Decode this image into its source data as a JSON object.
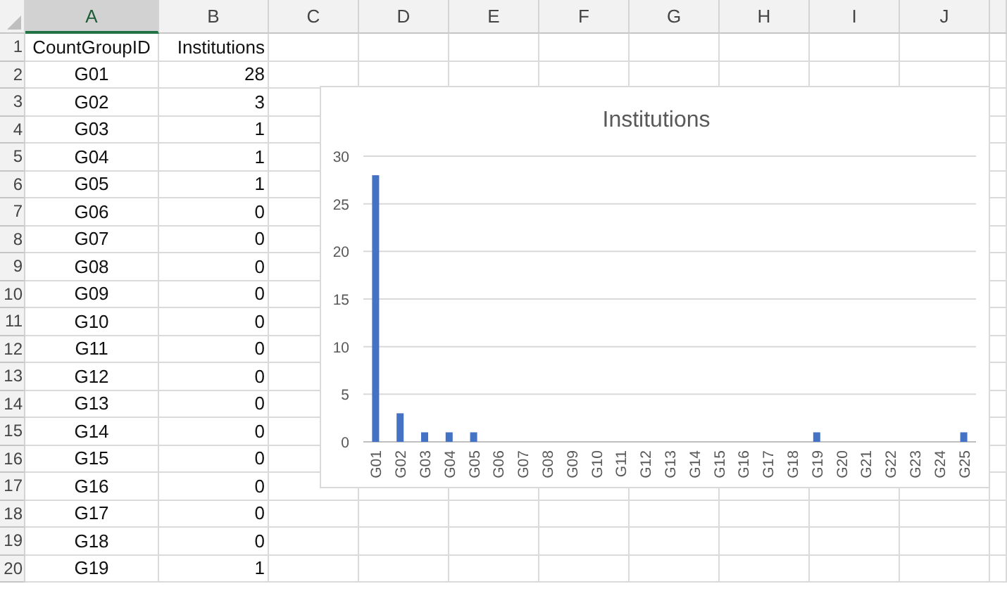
{
  "sheet": {
    "columns": [
      {
        "label": "A",
        "selected": true
      },
      {
        "label": "B",
        "selected": false
      },
      {
        "label": "C",
        "selected": false
      },
      {
        "label": "D",
        "selected": false
      },
      {
        "label": "E",
        "selected": false
      },
      {
        "label": "F",
        "selected": false
      },
      {
        "label": "G",
        "selected": false
      },
      {
        "label": "H",
        "selected": false
      },
      {
        "label": "I",
        "selected": false
      },
      {
        "label": "J",
        "selected": false
      }
    ],
    "rows": [
      {
        "number": "1",
        "cells": [
          "CountGroupID",
          "Institutions"
        ]
      },
      {
        "number": "2",
        "cells": [
          "G01",
          "28"
        ]
      },
      {
        "number": "3",
        "cells": [
          "G02",
          "3"
        ]
      },
      {
        "number": "4",
        "cells": [
          "G03",
          "1"
        ]
      },
      {
        "number": "5",
        "cells": [
          "G04",
          "1"
        ]
      },
      {
        "number": "6",
        "cells": [
          "G05",
          "1"
        ]
      },
      {
        "number": "7",
        "cells": [
          "G06",
          "0"
        ]
      },
      {
        "number": "8",
        "cells": [
          "G07",
          "0"
        ]
      },
      {
        "number": "9",
        "cells": [
          "G08",
          "0"
        ]
      },
      {
        "number": "10",
        "cells": [
          "G09",
          "0"
        ]
      },
      {
        "number": "11",
        "cells": [
          "G10",
          "0"
        ]
      },
      {
        "number": "12",
        "cells": [
          "G11",
          "0"
        ]
      },
      {
        "number": "13",
        "cells": [
          "G12",
          "0"
        ]
      },
      {
        "number": "14",
        "cells": [
          "G13",
          "0"
        ]
      },
      {
        "number": "15",
        "cells": [
          "G14",
          "0"
        ]
      },
      {
        "number": "16",
        "cells": [
          "G15",
          "0"
        ]
      },
      {
        "number": "17",
        "cells": [
          "G16",
          "0"
        ]
      },
      {
        "number": "18",
        "cells": [
          "G17",
          "0"
        ]
      },
      {
        "number": "19",
        "cells": [
          "G18",
          "0"
        ]
      },
      {
        "number": "20",
        "cells": [
          "G19",
          "1"
        ]
      }
    ]
  },
  "chart": {
    "chart_data": {
      "type": "bar",
      "grid": true,
      "categories": [
        "G01",
        "G02",
        "G03",
        "G04",
        "G05",
        "G06",
        "G07",
        "G08",
        "G09",
        "G10",
        "G11",
        "G12",
        "G13",
        "G14",
        "G15",
        "G16",
        "G17",
        "G18",
        "G19",
        "G20",
        "G21",
        "G22",
        "G23",
        "G24",
        "G25"
      ],
      "series": [
        {
          "name": "Institutions",
          "color": "#4472c4",
          "values": [
            28,
            3,
            1,
            1,
            1,
            0,
            0,
            0,
            0,
            0,
            0,
            0,
            0,
            0,
            0,
            0,
            0,
            0,
            1,
            0,
            0,
            0,
            0,
            0,
            1
          ]
        }
      ],
      "ylim": [
        0,
        30
      ],
      "yticks": [
        0,
        5,
        10,
        15,
        20,
        25,
        30
      ]
    }
  }
}
